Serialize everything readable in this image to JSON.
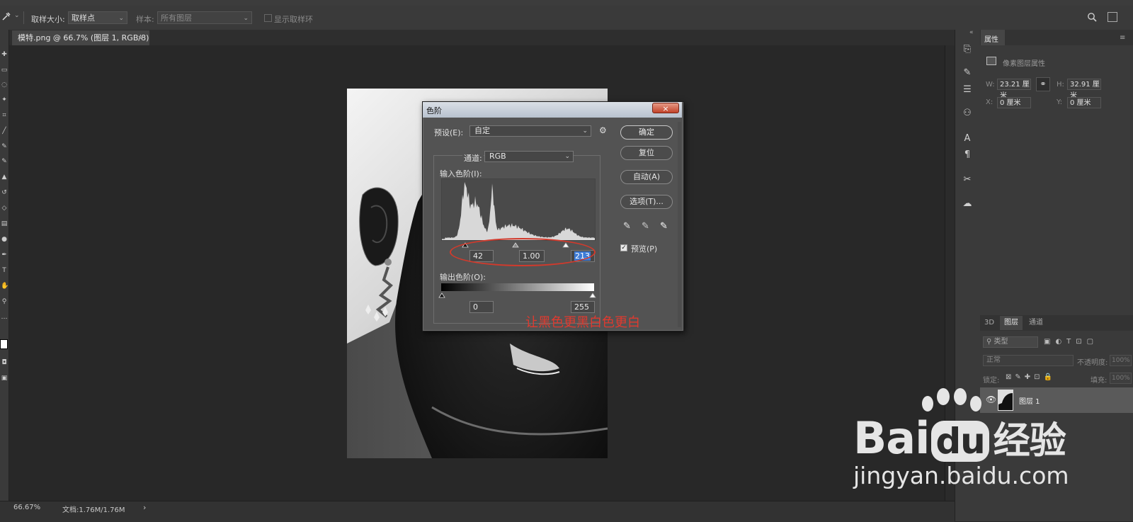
{
  "options_bar": {
    "sample_size_label": "取样大小:",
    "sample_size_value": "取样点",
    "sample_label": "样本:",
    "sample_value": "所有图层",
    "show_ring_label": "显示取样环"
  },
  "document": {
    "tab_title": "模特.png @ 66.7% (图层 1, RGB/8) *",
    "tab_close": "×"
  },
  "status": {
    "zoom": "66.67%",
    "doc_info": "文档:1.76M/1.76M",
    "arrow": "›"
  },
  "properties_panel": {
    "tab": "属性",
    "header": "像素图层属性",
    "w_label": "W:",
    "w_value": "23.21 厘米",
    "h_label": "H:",
    "h_value": "32.91 厘米",
    "x_label": "X:",
    "x_value": "0 厘米",
    "y_label": "Y:",
    "y_value": "0 厘米"
  },
  "layers_panel": {
    "tabs": [
      "3D",
      "图层",
      "通道"
    ],
    "active_tab": "图层",
    "filter_kind": "类型",
    "blend_mode": "正常",
    "opacity_label": "不透明度:",
    "opacity_value": "100%",
    "lock_label": "锁定:",
    "fill_label": "填充:",
    "fill_value": "100%",
    "layer_name": "图层 1"
  },
  "levels_dialog": {
    "title": "色阶",
    "close": "×",
    "preset_label": "预设(E):",
    "preset_value": "自定",
    "channel_label": "通道:",
    "channel_value": "RGB",
    "input_levels_label": "输入色阶(I):",
    "input_black": "42",
    "input_gamma": "1.00",
    "input_white": "213",
    "output_levels_label": "输出色阶(O):",
    "output_black": "0",
    "output_white": "255",
    "buttons": {
      "ok": "确定",
      "reset": "复位",
      "auto": "自动(A)",
      "options": "选项(T)..."
    },
    "preview_label": "预览(P)",
    "preview_checked": true
  },
  "annotation": "让黑色更黑白色更白",
  "watermark": {
    "brand": "Bai",
    "brand2": "du",
    "cn": "经验",
    "url": "jingyan.baidu.com"
  },
  "colors": {
    "annotation_red": "#e03a2f",
    "selection_blue": "#3d7bd6"
  }
}
